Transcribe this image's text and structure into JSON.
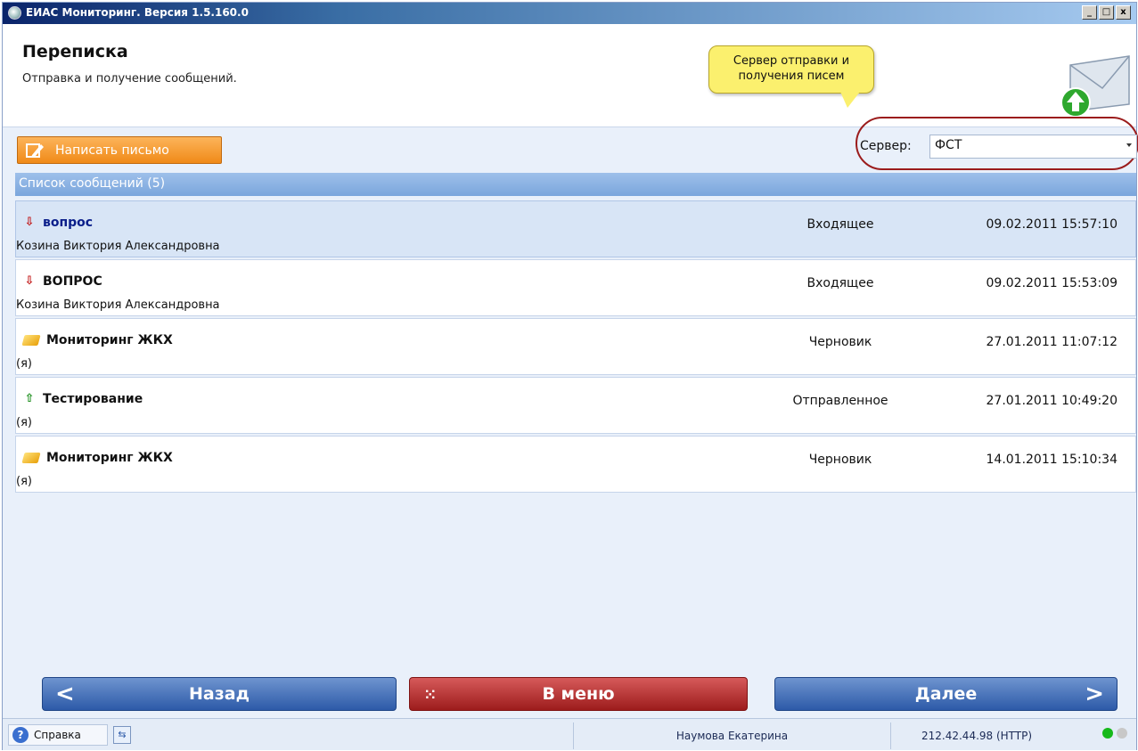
{
  "window": {
    "title": "ЕИАС Мониторинг. Версия 1.5.160.0",
    "buttons": [
      "_",
      "□",
      "x"
    ]
  },
  "header": {
    "title": "Переписка",
    "subtitle": "Отправка и получение сообщений.",
    "callout": "Сервер отправки и получения писем"
  },
  "toolbar": {
    "write_label": "Написать письмо",
    "server_label": "Сервер:",
    "server_value": "ФСТ"
  },
  "list": {
    "header": "Список сообщений (5)",
    "rows": [
      {
        "icon": "incoming-arrow-icon",
        "subject": "вопрос",
        "from": "Козина Виктория Александровна",
        "type": "Входящее",
        "date": "09.02.2011 15:57:10"
      },
      {
        "icon": "incoming-arrow-icon",
        "subject": "ВОПРОС",
        "from": "Козина Виктория Александровна",
        "type": "Входящее",
        "date": "09.02.2011 15:53:09"
      },
      {
        "icon": "draft-icon",
        "subject": "Мониторинг ЖКХ",
        "from": "(я)",
        "type": "Черновик",
        "date": "27.01.2011 11:07:12"
      },
      {
        "icon": "outgoing-arrow-icon",
        "subject": "Тестирование",
        "from": "(я)",
        "type": "Отправленное",
        "date": "27.01.2011 10:49:20"
      },
      {
        "icon": "draft-icon",
        "subject": "Мониторинг ЖКХ",
        "from": "(я)",
        "type": "Черновик",
        "date": "14.01.2011 15:10:34"
      }
    ]
  },
  "nav": {
    "back": "Назад",
    "menu": "В меню",
    "next": "Далее"
  },
  "status": {
    "help": "Справка",
    "user": "Наумова Екатерина",
    "connection": "212.42.44.98 (HTTP)"
  },
  "colors": {
    "accent": "#2d5aa8",
    "menu_button": "#9d1c1c",
    "write_button": "#f08a18",
    "highlight_oval": "#9b1c1c"
  }
}
